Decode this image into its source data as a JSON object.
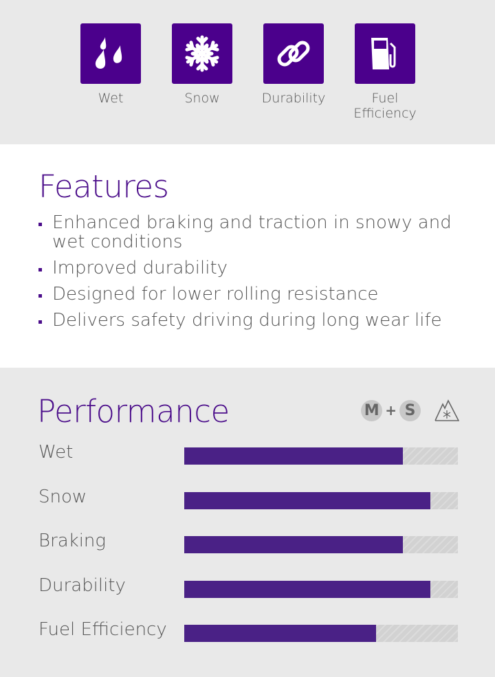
{
  "icons": [
    {
      "name": "wet-icon",
      "label": "Wet"
    },
    {
      "name": "snowflake-icon",
      "label": "Snow"
    },
    {
      "name": "chain-link-icon",
      "label": "Durability"
    },
    {
      "name": "fuel-pump-icon",
      "label": "Fuel Efficiency"
    }
  ],
  "features": {
    "title": "Features",
    "items": [
      "Enhanced braking and traction in  snowy and wet conditions",
      "Improved durability",
      "Designed for lower rolling  resistance",
      "Delivers safety driving during  long wear life"
    ]
  },
  "performance": {
    "title": "Performance",
    "badges": {
      "m": "M",
      "plus": "+",
      "s": "S",
      "icon": "three-peak-mountain-snowflake-icon"
    },
    "ratings": [
      {
        "label": "Wet",
        "value": 0.8
      },
      {
        "label": "Snow",
        "value": 0.9
      },
      {
        "label": "Braking",
        "value": 0.8
      },
      {
        "label": "Durability",
        "value": 0.9
      },
      {
        "label": "Fuel Efficiency",
        "value": 0.7
      }
    ]
  },
  "colors": {
    "accent": "#4b008c",
    "bar": "#4a2186"
  }
}
